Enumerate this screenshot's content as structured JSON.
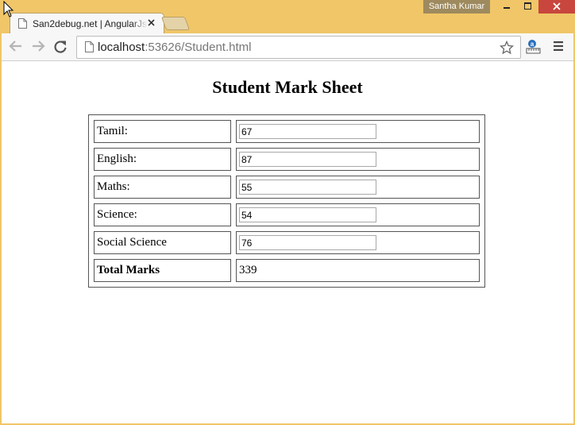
{
  "window": {
    "user_name": "Santha Kumar",
    "close_color": "#c8463d",
    "frame_color": "#f0c668"
  },
  "tabs": [
    {
      "title": "San2debug.net | AngularJs",
      "active": true
    }
  ],
  "toolbar": {
    "url_host": "localhost",
    "url_rest": ":53626/Student.html"
  },
  "page": {
    "title": "Student Mark Sheet",
    "subjects": [
      {
        "label": "Tamil:",
        "value": "67"
      },
      {
        "label": "English:",
        "value": "87"
      },
      {
        "label": "Maths:",
        "value": "55"
      },
      {
        "label": "Science:",
        "value": "54"
      },
      {
        "label": "Social Science",
        "value": "76"
      }
    ],
    "total": {
      "label": "Total Marks",
      "value": "339"
    }
  }
}
